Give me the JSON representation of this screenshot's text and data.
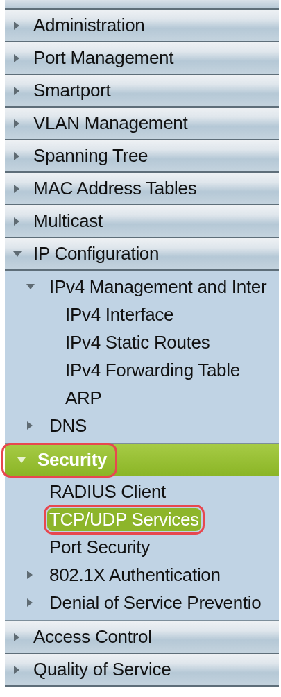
{
  "menu": [
    {
      "label": "Administration",
      "expanded": false,
      "selected": false,
      "highlighted": false
    },
    {
      "label": "Port Management",
      "expanded": false,
      "selected": false,
      "highlighted": false
    },
    {
      "label": "Smartport",
      "expanded": false,
      "selected": false,
      "highlighted": false
    },
    {
      "label": "VLAN Management",
      "expanded": false,
      "selected": false,
      "highlighted": false
    },
    {
      "label": "Spanning Tree",
      "expanded": false,
      "selected": false,
      "highlighted": false
    },
    {
      "label": "MAC Address Tables",
      "expanded": false,
      "selected": false,
      "highlighted": false
    },
    {
      "label": "Multicast",
      "expanded": false,
      "selected": false,
      "highlighted": false
    },
    {
      "label": "IP Configuration",
      "expanded": true,
      "selected": false,
      "highlighted": false,
      "children": [
        {
          "label": "IPv4 Management and Inter",
          "kind": "group",
          "expanded": true,
          "selected": false,
          "highlighted": false,
          "children": [
            {
              "label": "IPv4 Interface",
              "kind": "leaf",
              "selected": false,
              "highlighted": false
            },
            {
              "label": "IPv4 Static Routes",
              "kind": "leaf",
              "selected": false,
              "highlighted": false
            },
            {
              "label": "IPv4 Forwarding Table",
              "kind": "leaf",
              "selected": false,
              "highlighted": false
            },
            {
              "label": "ARP",
              "kind": "leaf",
              "selected": false,
              "highlighted": false
            }
          ]
        },
        {
          "label": "DNS",
          "kind": "group",
          "expanded": false,
          "selected": false,
          "highlighted": false
        }
      ]
    },
    {
      "label": "Security",
      "expanded": true,
      "selected": true,
      "highlighted": true,
      "children": [
        {
          "label": "RADIUS Client",
          "kind": "leaf",
          "selected": false,
          "highlighted": false
        },
        {
          "label": "TCP/UDP Services",
          "kind": "leaf",
          "selected": true,
          "highlighted": true
        },
        {
          "label": "Port Security",
          "kind": "leaf",
          "selected": false,
          "highlighted": false
        },
        {
          "label": "802.1X Authentication",
          "kind": "group",
          "expanded": false,
          "selected": false,
          "highlighted": false
        },
        {
          "label": "Denial of Service Preventio",
          "kind": "group",
          "expanded": false,
          "selected": false,
          "highlighted": false
        }
      ]
    },
    {
      "label": "Access Control",
      "expanded": false,
      "selected": false,
      "highlighted": false
    },
    {
      "label": "Quality of Service",
      "expanded": false,
      "selected": false,
      "highlighted": false
    }
  ]
}
